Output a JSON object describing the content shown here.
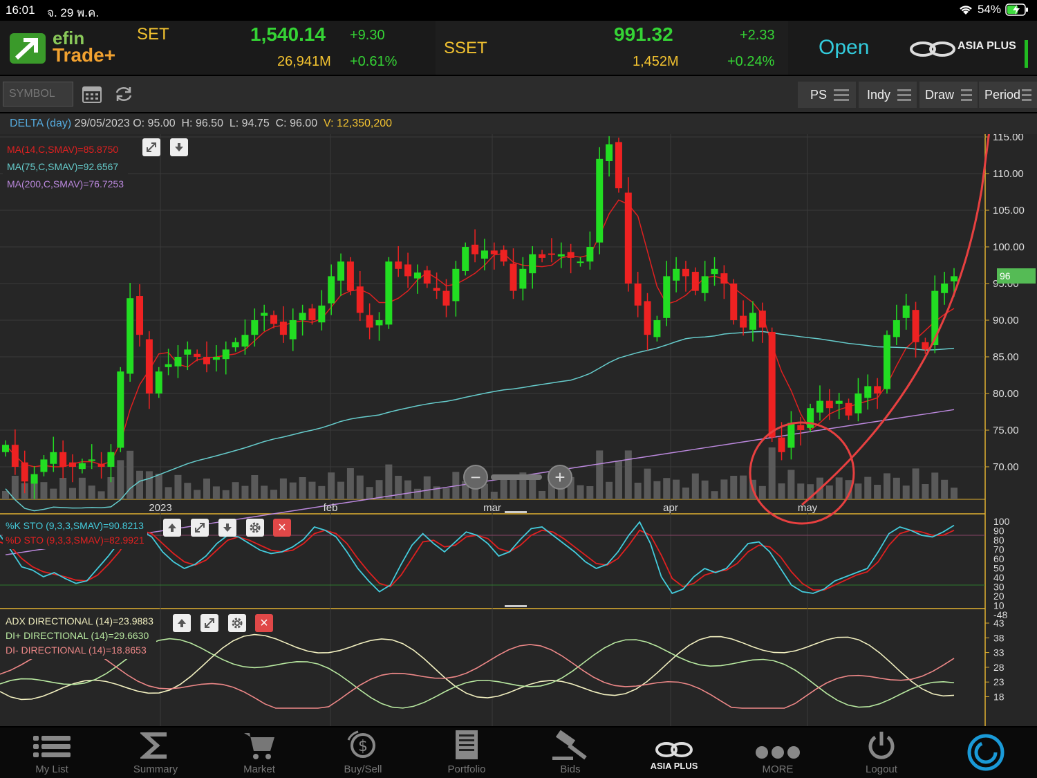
{
  "status": {
    "time": "16:01",
    "date": "จ. 29 พ.ค.",
    "battery": "54%"
  },
  "header": {
    "app_name_line1": "efin",
    "app_name_line2": "Trade+",
    "set": {
      "name": "SET",
      "value": "1,540.14",
      "change": "+9.30",
      "volume": "26,941M",
      "pct": "+0.61%"
    },
    "sset": {
      "name": "SSET",
      "value": "991.32",
      "change": "+2.33",
      "volume": "1,452M",
      "pct": "+0.24%"
    },
    "market_status": "Open",
    "broker": "ASIA PLUS"
  },
  "toolbar": {
    "symbol_placeholder": "SYMBOL",
    "buttons": [
      "PS",
      "Indy",
      "Draw",
      "Period"
    ]
  },
  "info": {
    "symbol": "DELTA (day)",
    "date": "29/05/2023",
    "o_label": "O:",
    "o": "95.00",
    "h_label": "H:",
    "h": "96.50",
    "l_label": "L:",
    "l": "94.75",
    "c_label": "C:",
    "c": "96.00",
    "v_label": "V:",
    "v": "12,350,200"
  },
  "legends": {
    "ma14": "MA(14,C,SMAV)=85.8750",
    "ma75": "MA(75,C,SMAV)=92.6567",
    "ma200": "MA(200,C,SMAV)=76.7253",
    "stok": "%K STO (9,3,3,SMAV)=90.8213",
    "stod": "%D STO (9,3,3,SMAV)=82.9921",
    "adx": "ADX DIRECTIONAL (14)=23.9883",
    "diplus": "DI+ DIRECTIONAL (14)=29.6630",
    "diminus": "DI- DIRECTIONAL (14)=18.8653"
  },
  "colors": {
    "up": "#22dd22",
    "down": "#ee2222",
    "ma14": "#e02020",
    "ma75": "#66cccc",
    "ma200": "#bb88dd",
    "accent": "#f2c230"
  },
  "chart_data": {
    "type": "candlestick",
    "price_axis": {
      "ticks": [
        "115.00",
        "110.00",
        "105.00",
        "100.00",
        "95.00",
        "90.00",
        "85.00",
        "80.00",
        "75.00",
        "70.00"
      ],
      "range": [
        65,
        115
      ]
    },
    "last_price_tag": "96",
    "x_labels": [
      "2023",
      "feb",
      "mar",
      "apr",
      "may"
    ],
    "sto_axis": {
      "ticks": [
        "100",
        "90",
        "80",
        "70",
        "60",
        "50",
        "40",
        "30",
        "20",
        "10",
        "-48"
      ]
    },
    "adx_axis": {
      "ticks": [
        "43",
        "38",
        "33",
        "28",
        "23",
        "18"
      ]
    },
    "close_series": [
      73,
      70,
      68,
      69,
      71,
      72,
      70,
      70,
      70.5,
      71,
      70,
      72,
      83,
      93,
      88,
      80,
      83,
      84,
      85,
      86,
      85,
      84,
      85,
      86,
      87,
      88,
      90,
      91,
      89.5,
      88,
      90,
      91,
      90,
      92,
      96,
      98,
      94,
      91,
      89,
      90,
      98,
      97,
      96,
      96.5,
      95,
      94,
      92,
      97,
      100,
      99,
      99.5,
      99,
      98,
      94,
      97,
      99,
      98.5,
      99,
      99,
      98.5,
      98,
      100,
      112,
      114,
      108,
      95,
      92,
      88,
      90,
      96,
      97,
      96,
      94,
      96,
      97,
      95,
      90,
      89,
      91,
      89,
      74,
      72,
      76,
      75,
      78,
      79,
      78,
      79,
      77,
      80,
      81,
      80,
      88,
      90,
      92,
      87,
      86,
      94,
      95,
      96
    ],
    "stok_series": [
      80,
      62,
      42,
      38,
      30,
      35,
      28,
      22,
      25,
      40,
      55,
      72,
      92,
      86,
      78,
      60,
      48,
      40,
      45,
      55,
      70,
      80,
      78,
      70,
      62,
      58,
      60,
      66,
      75,
      90,
      86,
      78,
      60,
      40,
      25,
      12,
      20,
      45,
      68,
      82,
      70,
      60,
      72,
      84,
      80,
      70,
      55,
      60,
      75,
      88,
      90,
      80,
      70,
      60,
      48,
      40,
      45,
      60,
      80,
      96,
      70,
      30,
      10,
      15,
      30,
      40,
      35,
      40,
      55,
      70,
      72,
      60,
      40,
      20,
      12,
      10,
      15,
      25,
      30,
      35,
      40,
      60,
      82,
      90,
      86,
      80,
      78,
      84,
      92
    ],
    "stod_series": [
      72,
      66,
      52,
      42,
      36,
      33,
      30,
      26,
      25,
      32,
      45,
      60,
      80,
      86,
      82,
      70,
      58,
      48,
      44,
      50,
      62,
      74,
      78,
      74,
      68,
      62,
      60,
      62,
      70,
      82,
      86,
      82,
      70,
      52,
      36,
      22,
      18,
      32,
      52,
      72,
      74,
      66,
      68,
      78,
      80,
      76,
      64,
      60,
      68,
      80,
      86,
      84,
      76,
      66,
      56,
      46,
      44,
      52,
      68,
      86,
      80,
      56,
      28,
      18,
      22,
      32,
      36,
      38,
      46,
      60,
      68,
      66,
      54,
      36,
      22,
      14,
      14,
      20,
      26,
      32,
      36,
      48,
      68,
      82,
      86,
      84,
      80,
      80,
      86
    ]
  },
  "overlay": {
    "minus": "−",
    "plus": "+",
    "close": "×"
  },
  "nav": [
    {
      "label": "My List",
      "icon": "list-icon"
    },
    {
      "label": "Summary",
      "icon": "sigma-icon"
    },
    {
      "label": "Market",
      "icon": "cart-icon"
    },
    {
      "label": "Buy/Sell",
      "icon": "dollar-icon"
    },
    {
      "label": "Portfolio",
      "icon": "document-icon"
    },
    {
      "label": "Bids",
      "icon": "gavel-icon"
    },
    {
      "label": "ASIA PLUS",
      "icon": "asiaplus-logo-icon"
    },
    {
      "label": "MORE",
      "icon": "more-icon"
    },
    {
      "label": "Logout",
      "icon": "power-icon"
    }
  ]
}
